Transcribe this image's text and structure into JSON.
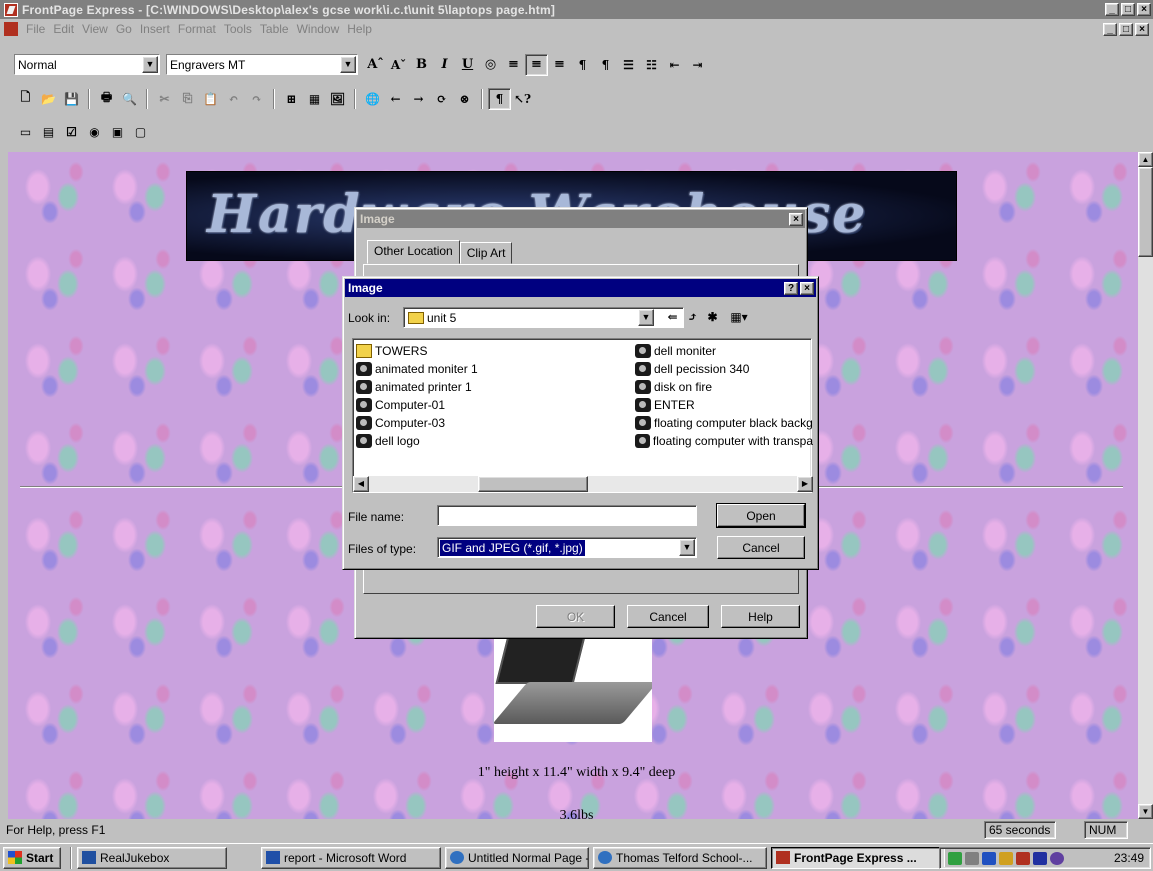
{
  "window": {
    "title": "FrontPage Express - [C:\\WINDOWS\\Desktop\\alex's gcse work\\i.c.t\\unit 5\\laptops page.htm]",
    "controls": [
      "_",
      "\u0018",
      "×"
    ]
  },
  "menu": [
    {
      "label": "File"
    },
    {
      "label": "Edit"
    },
    {
      "label": "View"
    },
    {
      "label": "Go"
    },
    {
      "label": "Insert"
    },
    {
      "label": "Format"
    },
    {
      "label": "Tools"
    },
    {
      "label": "Table"
    },
    {
      "label": "Window"
    },
    {
      "label": "Help"
    }
  ],
  "format_toolbar": {
    "style_value": "Normal",
    "font_value": "Engravers MT",
    "buttons": [
      "Aˆ",
      "Aˇ",
      "B",
      "I",
      "U"
    ]
  },
  "page": {
    "banner_text": "Hardware Warehouse",
    "caption_dimensions": "1\" height x 11.4\" width x 9.4\" deep",
    "caption_weight": "3.6lbs"
  },
  "image_dialog": {
    "title": "Image",
    "close": "×",
    "tabs": [
      "Other Location",
      "Clip Art"
    ],
    "ok_label": "OK",
    "cancel_label": "Cancel",
    "help_label": "Help"
  },
  "file_dialog": {
    "title": "Image",
    "help_btn": "?",
    "close_btn": "×",
    "look_in_label": "Look in:",
    "look_in_value": "unit 5",
    "files_left": [
      {
        "name": "TOWERS",
        "icon": "folder"
      },
      {
        "name": "animated moniter 1",
        "icon": "image"
      },
      {
        "name": "animated printer 1",
        "icon": "image"
      },
      {
        "name": "Computer-01",
        "icon": "image"
      },
      {
        "name": "Computer-03",
        "icon": "image"
      },
      {
        "name": "dell logo",
        "icon": "image"
      }
    ],
    "files_right": [
      {
        "name": "dell moniter",
        "icon": "image"
      },
      {
        "name": "dell pecission 340",
        "icon": "image"
      },
      {
        "name": "disk on fire",
        "icon": "image"
      },
      {
        "name": "ENTER",
        "icon": "image"
      },
      {
        "name": "floating computer black backg",
        "icon": "image"
      },
      {
        "name": "floating computer with transpa",
        "icon": "image"
      }
    ],
    "file_name_label": "File name:",
    "file_name_value": "",
    "file_type_label": "Files of type:",
    "file_type_value": "GIF and JPEG (*.gif, *.jpg)",
    "open_label": "Open",
    "cancel_label": "Cancel"
  },
  "status": {
    "help_text": "For Help, press F1",
    "timer": "65 seconds",
    "num": "NUM"
  },
  "taskbar": {
    "start_label": "Start",
    "items": [
      {
        "label": "RealJukebox"
      },
      {
        "label": "report - Microsoft Word"
      },
      {
        "label": "Untitled Normal Page - ..."
      },
      {
        "label": "Thomas Telford School-..."
      },
      {
        "label": "FrontPage Express ..."
      }
    ],
    "clock": "23:49"
  },
  "colors": {
    "title_inactive": "#808080",
    "title_active": "#000080",
    "page_background": "#c9a2de"
  }
}
